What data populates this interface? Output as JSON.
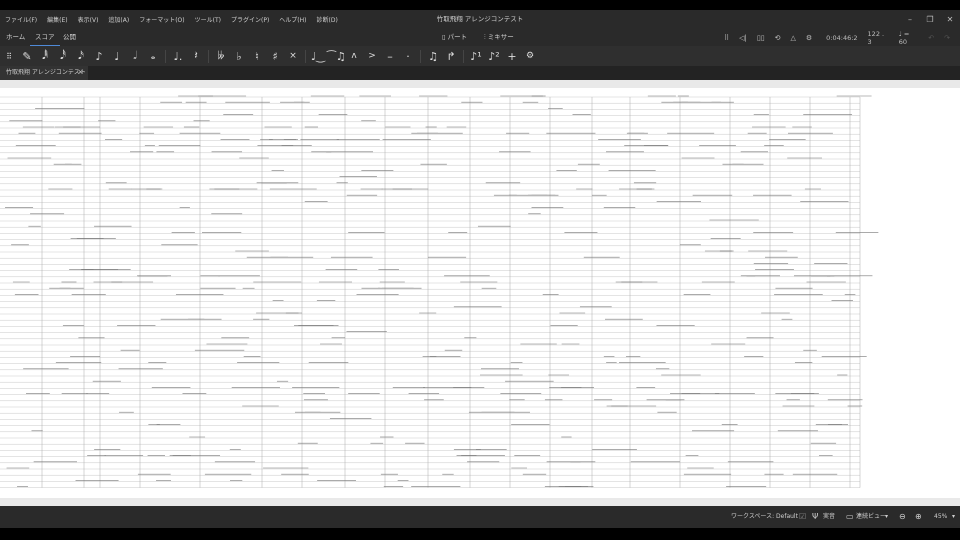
{
  "window": {
    "title": "竹取飛翔 アレンジコンテスト",
    "minimize": "–",
    "maximize": "❐",
    "close": "✕"
  },
  "menu": [
    "ファイル(F)",
    "編集(E)",
    "表示(V)",
    "追加(A)",
    "フォーマット(O)",
    "ツール(T)",
    "プラグイン(P)",
    "ヘルプ(H)",
    "診断(D)"
  ],
  "tabs": {
    "home": "ホーム",
    "score": "スコア",
    "publish": "公開"
  },
  "center": {
    "parts": "パート",
    "mixer": "ミキサー"
  },
  "playback": {
    "time": "0:04:46:2",
    "measure": "122 . 3",
    "tempo": "♩ = 60"
  },
  "document_tab": {
    "label": "竹取飛翔 アレンジコンテスト",
    "close": "✕"
  },
  "status": {
    "workspace": "ワークスペース: Default",
    "concert_pitch": "実音",
    "view_mode": "連続ビュー",
    "zoom": "45%"
  }
}
